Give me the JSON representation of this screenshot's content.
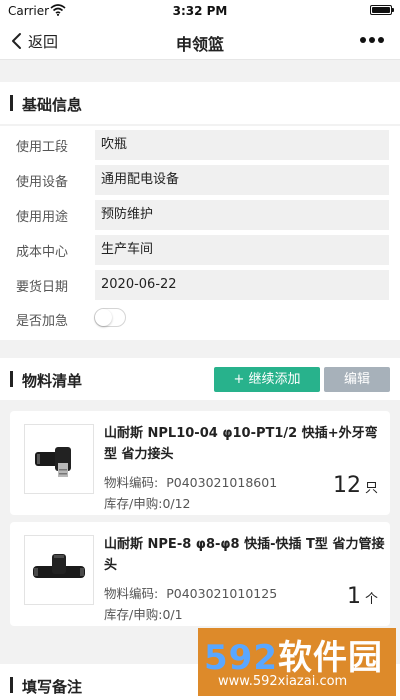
{
  "status_bar": {
    "carrier": "Carrier",
    "time": "3:32 PM"
  },
  "nav": {
    "back_label": "返回",
    "title": "申领篮"
  },
  "basic_info": {
    "title": "基础信息",
    "fields": [
      {
        "label": "使用工段",
        "value": "吹瓶"
      },
      {
        "label": "使用设备",
        "value": "通用配电设备"
      },
      {
        "label": "使用用途",
        "value": "预防维护"
      },
      {
        "label": "成本中心",
        "value": "生产车间"
      },
      {
        "label": "要货日期",
        "value": "2020-06-22"
      }
    ],
    "urgent": {
      "label": "是否加急",
      "on": false
    }
  },
  "materials": {
    "title": "物料清单",
    "add_label": "+ 继续添加",
    "edit_label": "编辑",
    "code_label": "物料编码:",
    "stock_label": "库存/申购:",
    "items": [
      {
        "name": "山耐斯 NPL10-04 φ10-PT1/2 快插+外牙弯型 省力接头",
        "code": "P0403021018601",
        "stock": "0/12",
        "qty": "12",
        "unit": "只"
      },
      {
        "name": "山耐斯 NPE-8 φ8-φ8 快插-快插 T型 省力管接头",
        "code": "P0403021010125",
        "stock": "0/1",
        "qty": "1",
        "unit": "个"
      }
    ]
  },
  "remarks": {
    "title": "填写备注"
  },
  "watermark": {
    "logo_num": "592",
    "logo_text": "软件园",
    "url": "www.592xiazai.com"
  },
  "colors": {
    "accent": "#28b28c",
    "edit_button": "#a7b1ba",
    "watermark_bg": "#dd8a2a"
  }
}
